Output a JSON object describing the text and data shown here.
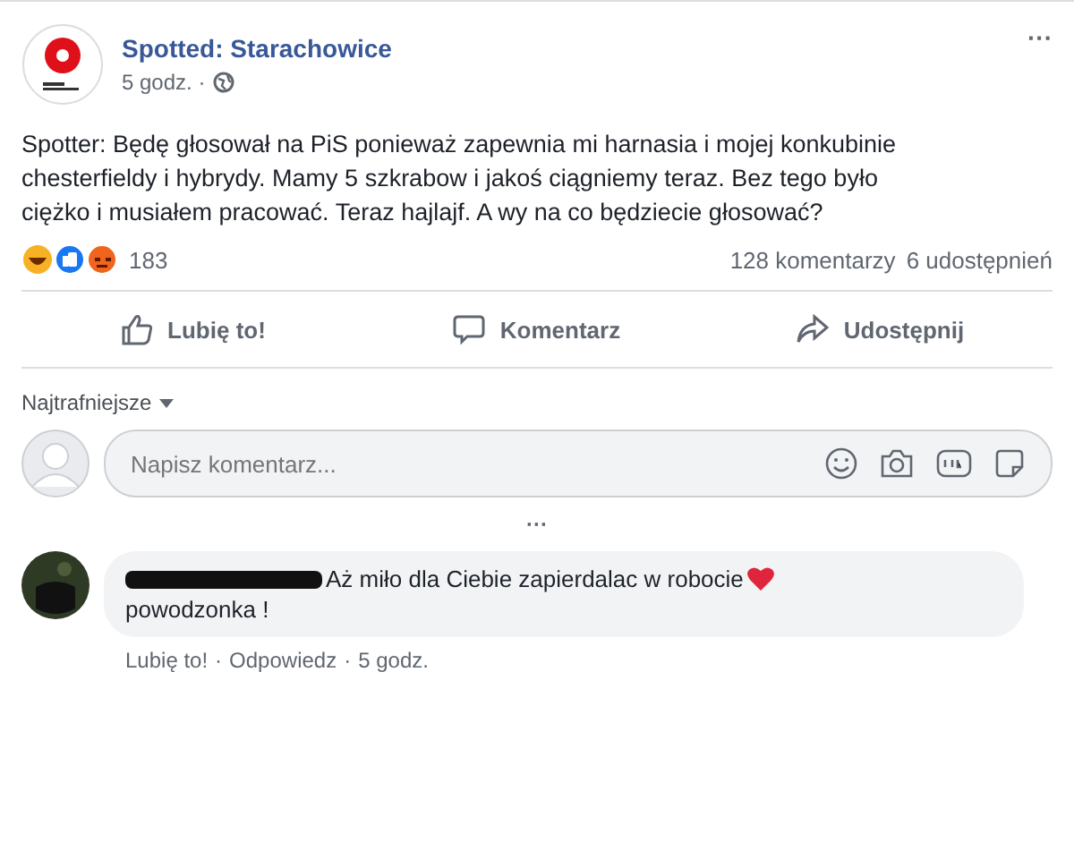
{
  "post": {
    "author": "Spotted: Starachowice",
    "time": "5 godz. ·",
    "more": "···",
    "text": "Spotter: Będę głosował na PiS ponieważ zapewnia mi harnasia i mojej konkubinie chesterfieldy i hybrydy. Mamy 5 szkrabow i jakoś ciągniemy teraz. Bez tego było ciężko i musiałem pracować. Teraz hajlajf. A wy na co będziecie głosować?",
    "reactions_count": "183",
    "comments_count": "128 komentarzy",
    "shares_count": "6 udostępnień"
  },
  "actions": [
    {
      "kind": "like",
      "label": "Lubię to!"
    },
    {
      "kind": "comment",
      "label": "Komentarz"
    },
    {
      "kind": "share",
      "label": "Udostępnij"
    }
  ],
  "sort": {
    "label": "Najtrafniejsze"
  },
  "comment_input": {
    "placeholder": "Napisz komentarz..."
  },
  "more_comments": "···",
  "comment": {
    "text": "Aż miło dla Ciebie zapierdalac w robocie",
    "second_line": "powodzonka !",
    "links": [
      "Lubię to!",
      "Odpowiedz",
      "5 godz."
    ],
    "separator": "·"
  }
}
